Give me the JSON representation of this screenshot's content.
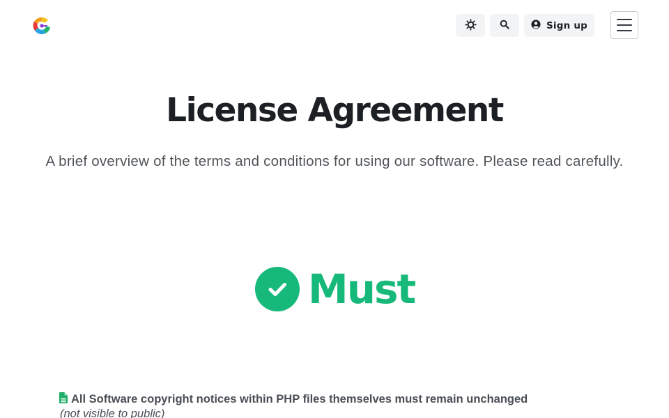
{
  "header": {
    "logo_icon": "brand-logo-icon",
    "theme_toggle_icon": "sun-gear-icon",
    "search_icon": "search-icon",
    "signup": {
      "icon": "user-circle-icon",
      "label": "Sign up"
    },
    "menu_icon": "hamburger-menu-icon"
  },
  "hero": {
    "title": "License Agreement",
    "subtitle": "A brief overview of the terms and conditions for using our software. Please read carefully."
  },
  "must_section": {
    "icon": "check-circle-icon",
    "label": "Must",
    "color": "#17b97a",
    "items": [
      {
        "icon": "file-icon",
        "text": "All Software copyright notices within PHP files themselves must remain unchanged",
        "note": "(not visible to public)"
      }
    ]
  },
  "colors": {
    "accent_green": "#17b97a",
    "item_icon_green": "#1fae6a",
    "button_bg": "#f3f4f6"
  }
}
